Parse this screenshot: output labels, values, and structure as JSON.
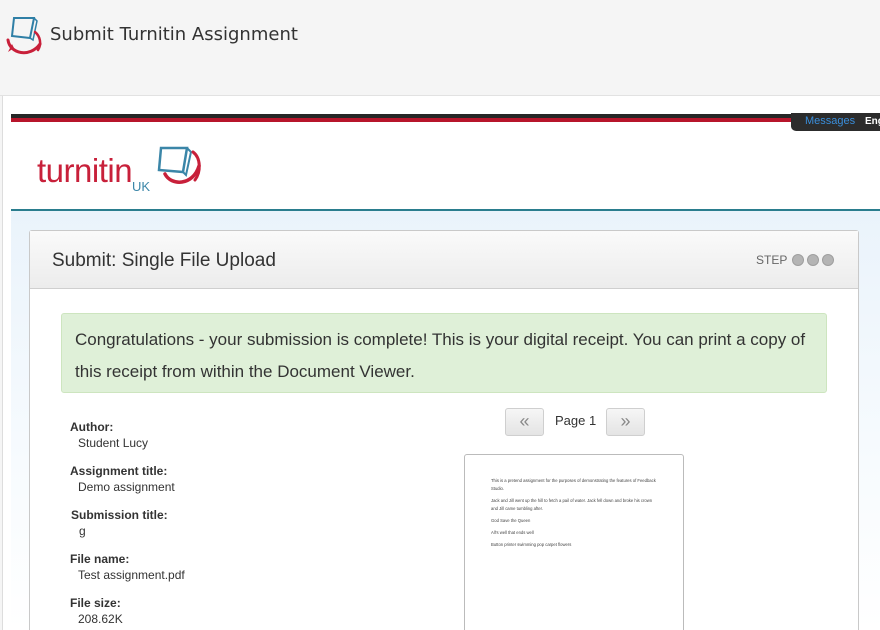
{
  "header": {
    "title": "Submit Turnitin Assignment",
    "icon": "turnitin-app-icon"
  },
  "topbar": {
    "messages": "Messages",
    "language": "English"
  },
  "logo": {
    "word": "turnitin",
    "suffix": "UK"
  },
  "panel": {
    "title": "Submit: Single File Upload",
    "step_label": "STEP",
    "steps": 3
  },
  "alert": {
    "message": "Congratulations - your submission is complete! This is your digital receipt. You can print a copy of this receipt from within the Document Viewer."
  },
  "receipt": {
    "author_label": "Author:",
    "author": "Student Lucy",
    "assignment_label": "Assignment title:",
    "assignment": "Demo assignment",
    "submission_label": "Submission title:",
    "submission": "g",
    "filename_label": "File name:",
    "filename": "Test assignment.pdf",
    "filesize_label": "File size:",
    "filesize": "208.62K"
  },
  "viewer": {
    "prev": "«",
    "next": "»",
    "page_label": "Page 1",
    "lines": [
      "This is a pretend assignment for the purposes of demonstrating the features of Feedback Studio.",
      "Jack and Jill went up the hill to fetch a pail of water. Jack fell down and broke his crown and Jill came tumbling after.",
      "God Save the Queen",
      "All's well that ends well",
      "Button printer swimming pop carpet flowers"
    ]
  },
  "colors": {
    "brand_red": "#c8203a",
    "teal": "#2a7d8e",
    "alert_bg": "#dff0d8"
  }
}
